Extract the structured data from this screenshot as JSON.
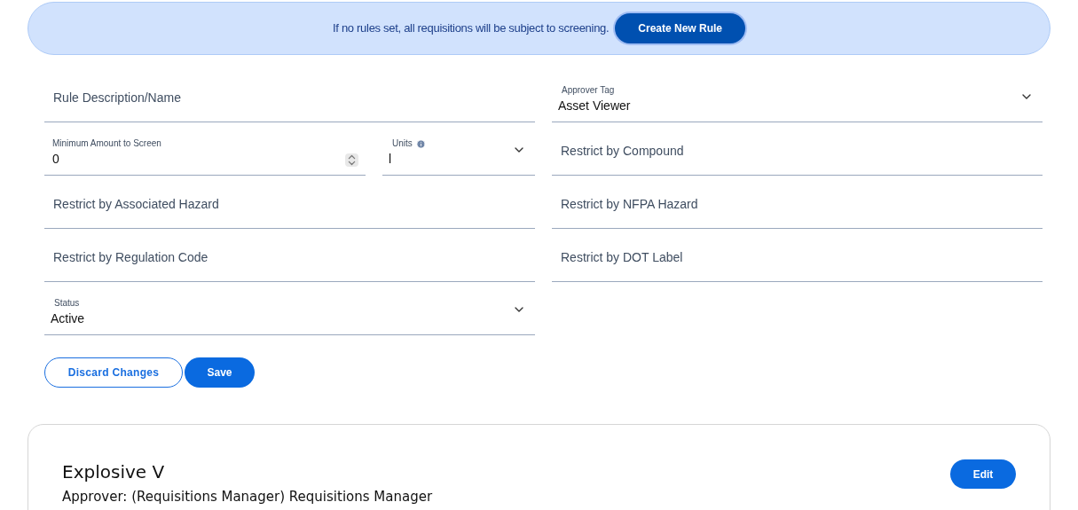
{
  "banner": {
    "message": "If no rules set, all requisitions will be subject to screening.",
    "button": "Create New Rule"
  },
  "form_rows": [
    {
      "left": [
        {
          "kind": "text",
          "placeholder": "Rule Description/Name"
        }
      ],
      "right": [
        {
          "kind": "select",
          "label": "Approver Tag",
          "value": "Asset Viewer"
        }
      ]
    },
    {
      "left": [
        {
          "kind": "number",
          "label": "Minimum Amount to Screen",
          "value": "0"
        },
        {
          "kind": "select",
          "label": "Units",
          "value": "l",
          "info": true
        }
      ],
      "right": [
        {
          "kind": "text",
          "placeholder": "Restrict by Compound"
        }
      ]
    },
    {
      "left": [
        {
          "kind": "text",
          "placeholder": "Restrict by Associated Hazard"
        }
      ],
      "right": [
        {
          "kind": "text",
          "placeholder": "Restrict by NFPA Hazard"
        }
      ]
    },
    {
      "left": [
        {
          "kind": "text",
          "placeholder": "Restrict by Regulation Code"
        }
      ],
      "right": [
        {
          "kind": "text",
          "placeholder": "Restrict by DOT Label"
        }
      ]
    },
    {
      "left": [
        {
          "kind": "select",
          "label": "Status",
          "value": "Active"
        }
      ],
      "right": []
    }
  ],
  "actions": {
    "discard": "Discard Changes",
    "save": "Save"
  },
  "rule_card": {
    "title": "Explosive V",
    "approver": "Approver: (Requisitions Manager) Requisitions Manager",
    "button": "Edit"
  }
}
